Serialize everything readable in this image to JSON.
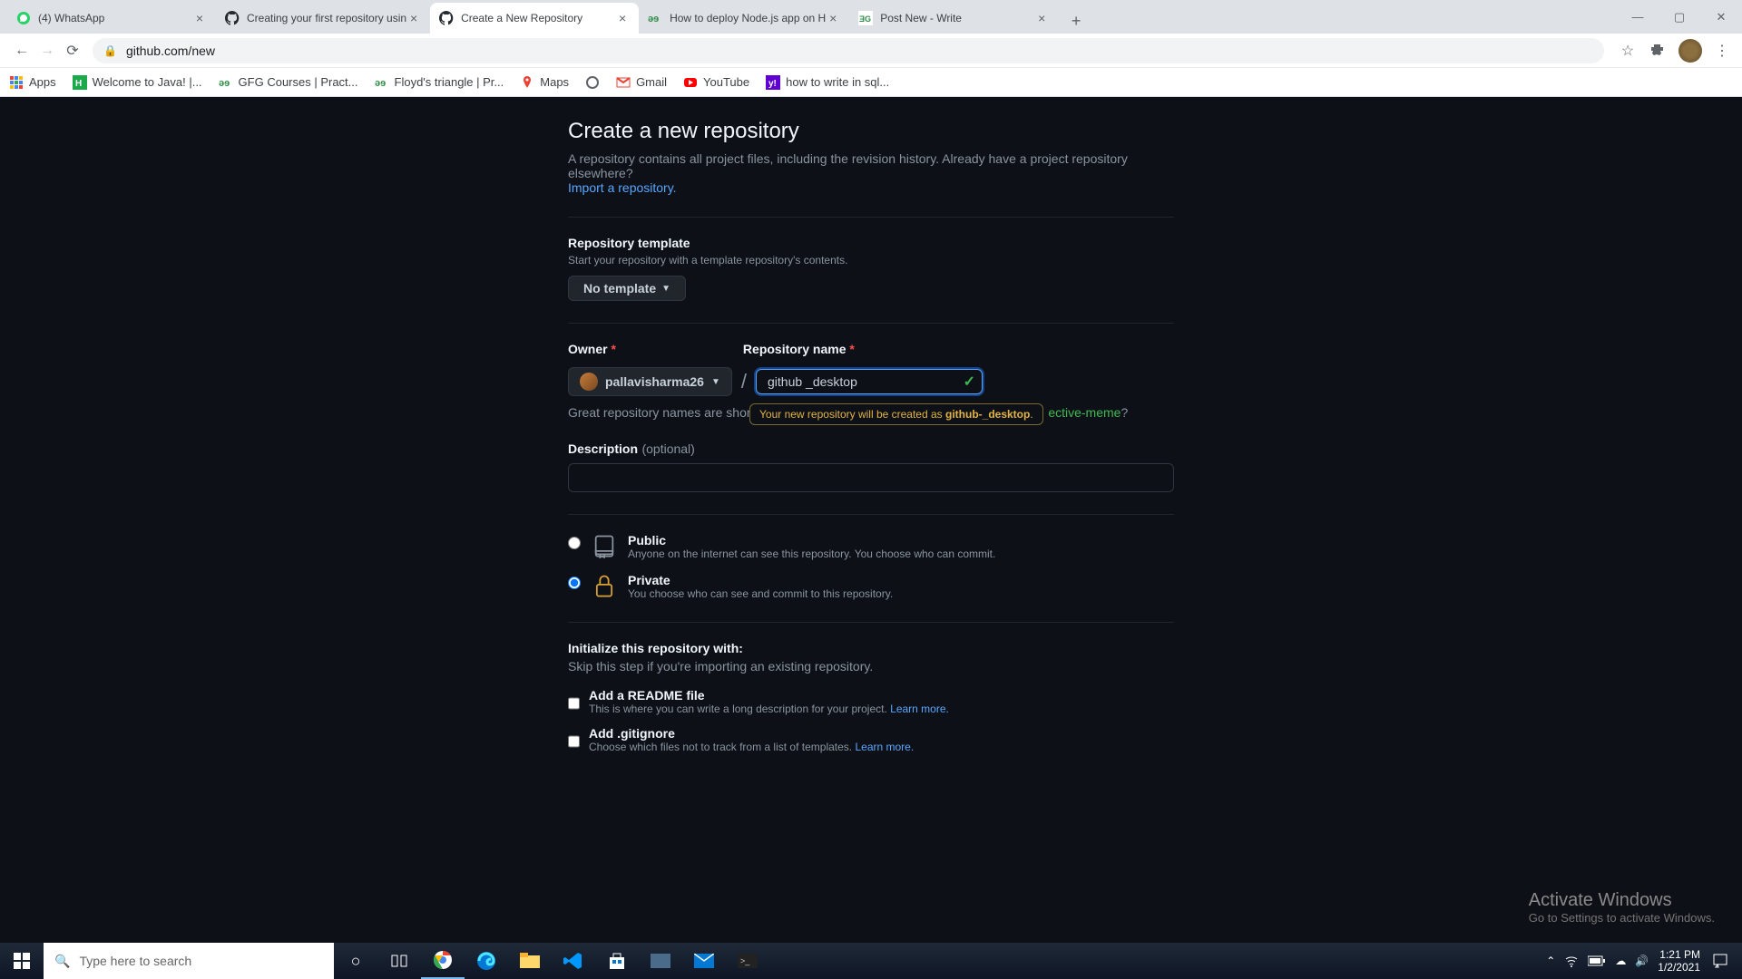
{
  "browser": {
    "tabs": [
      {
        "title": "(4) WhatsApp",
        "favicon": "whatsapp"
      },
      {
        "title": "Creating your first repository usin",
        "favicon": "github"
      },
      {
        "title": "Create a New Repository",
        "favicon": "github",
        "active": true
      },
      {
        "title": "How to deploy Node.js app on H",
        "favicon": "gfg"
      },
      {
        "title": "Post New - Write",
        "favicon": "gfg"
      }
    ],
    "url": "github.com/new",
    "bookmarks": [
      {
        "label": "Apps",
        "icon": "apps"
      },
      {
        "label": "Welcome to Java! |...",
        "icon": "hr"
      },
      {
        "label": "GFG Courses | Pract...",
        "icon": "gfg"
      },
      {
        "label": "Floyd's triangle | Pr...",
        "icon": "gfg"
      },
      {
        "label": "Maps",
        "icon": "maps"
      },
      {
        "label": "",
        "icon": "ring"
      },
      {
        "label": "Gmail",
        "icon": "gmail"
      },
      {
        "label": "YouTube",
        "icon": "youtube"
      },
      {
        "label": "how to write in sql...",
        "icon": "yahoo"
      }
    ]
  },
  "page": {
    "title": "Create a new repository",
    "subtitle_a": "A repository contains all project files, including the revision history. Already have a project repository elsewhere?",
    "import_link": "Import a repository.",
    "template_label": "Repository template",
    "template_hint": "Start your repository with a template repository's contents.",
    "template_btn": "No template",
    "owner_label": "Owner",
    "owner": "pallavisharma26",
    "repo_label": "Repository name",
    "repo_value": "github _desktop",
    "name_hint_prefix": "Great repository names are short",
    "tooltip_text": "Your new repository will be created as ",
    "tooltip_name": "github-_desktop",
    "name_hint_suffix": "ective-meme",
    "desc_label": "Description",
    "desc_optional": "(optional)",
    "public_label": "Public",
    "public_hint": "Anyone on the internet can see this repository. You choose who can commit.",
    "private_label": "Private",
    "private_hint": "You choose who can see and commit to this repository.",
    "init_label": "Initialize this repository with:",
    "init_hint": "Skip this step if you're importing an existing repository.",
    "readme_label": "Add a README file",
    "readme_hint": "This is where you can write a long description for your project. ",
    "learn_more": "Learn more.",
    "gitignore_label": "Add .gitignore",
    "gitignore_hint": "Choose which files not to track from a list of templates. "
  },
  "watermark": {
    "title": "Activate Windows",
    "sub": "Go to Settings to activate Windows."
  },
  "taskbar": {
    "search_placeholder": "Type here to search",
    "time": "1:21 PM",
    "date": "1/2/2021"
  }
}
